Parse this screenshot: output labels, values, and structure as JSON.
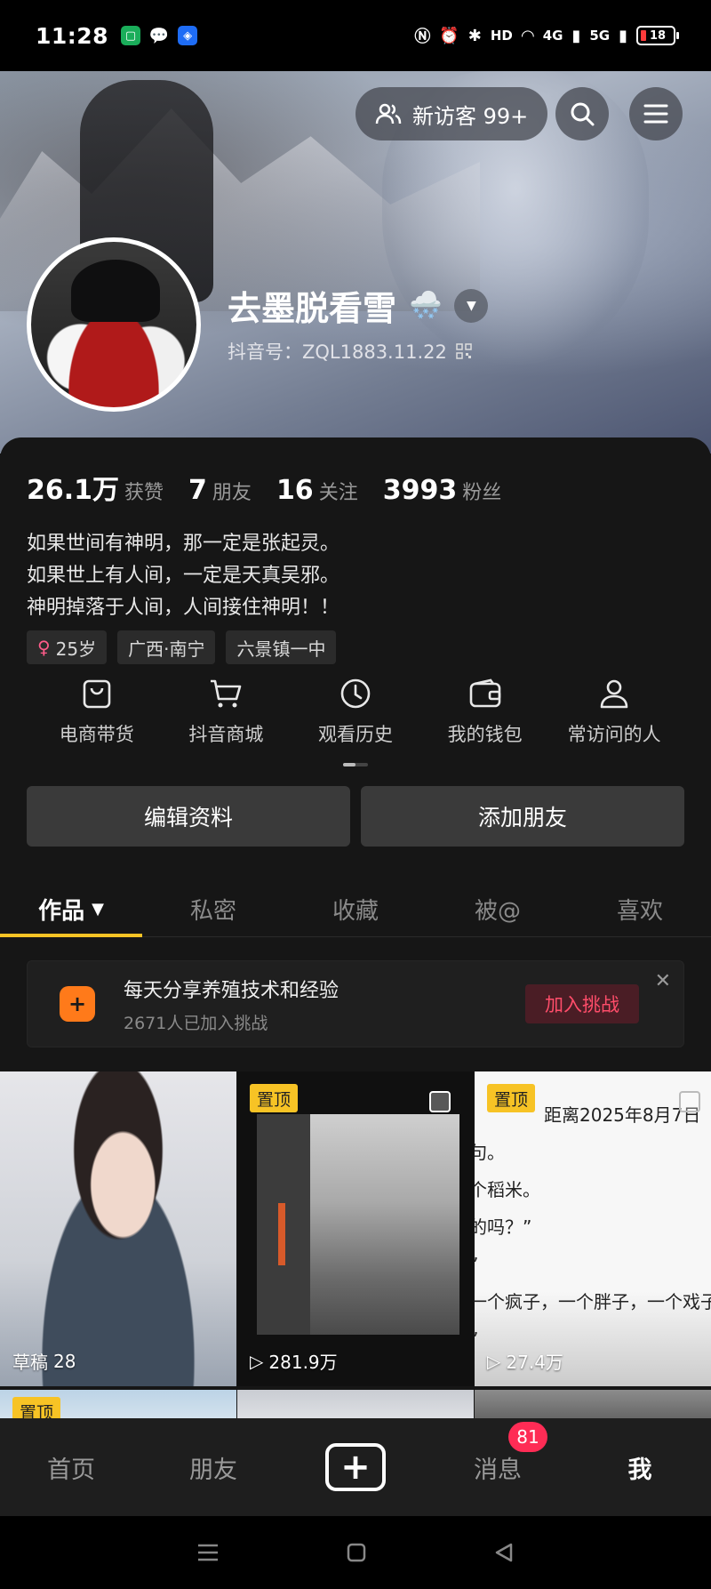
{
  "status_bar": {
    "time": "11:28",
    "battery": "18",
    "network_labels": [
      "HD",
      "4G",
      "5G"
    ]
  },
  "header": {
    "visitor_label": "新访客 99+",
    "nickname": "去墨脱看雪",
    "nickname_emoji": "🌨️",
    "douyin_id": "抖音号：ZQL1883.11.22"
  },
  "stats": [
    {
      "value": "26.1万",
      "label": "获赞"
    },
    {
      "value": "7",
      "label": "朋友"
    },
    {
      "value": "16",
      "label": "关注"
    },
    {
      "value": "3993",
      "label": "粉丝"
    }
  ],
  "bio": [
    "如果世间有神明，那一定是张起灵。",
    "如果世上有人间，一定是天真吴邪。",
    "神明掉落于人间，人间接住神明！！"
  ],
  "tags": [
    {
      "icon": "female-icon",
      "text": "25岁"
    },
    {
      "text": "广西·南宁"
    },
    {
      "text": "六景镇一中"
    }
  ],
  "shortcuts": [
    {
      "icon": "shopping-bag-icon",
      "label": "电商带货"
    },
    {
      "icon": "cart-icon",
      "label": "抖音商城"
    },
    {
      "icon": "clock-icon",
      "label": "观看历史"
    },
    {
      "icon": "wallet-icon",
      "label": "我的钱包"
    },
    {
      "icon": "person-icon",
      "label": "常访问的人"
    }
  ],
  "actions": {
    "edit_profile": "编辑资料",
    "add_friend": "添加朋友"
  },
  "tabs": [
    {
      "label": "作品",
      "active": true
    },
    {
      "label": "私密"
    },
    {
      "label": "收藏"
    },
    {
      "label": "被@"
    },
    {
      "label": "喜欢"
    }
  ],
  "challenge": {
    "title": "每天分享养殖技术和经验",
    "subtitle": "2671人已加入挑战",
    "join_label": "加入挑战",
    "close_symbol": "✕"
  },
  "grid": {
    "pin_label": "置顶",
    "items": [
      {
        "meta_prefix": "草稿",
        "meta_value": "28",
        "pinned": false
      },
      {
        "meta_value": "281.9万",
        "pinned": true
      },
      {
        "meta_value": "27.4万",
        "pinned": true
      }
    ],
    "cell3_text_lines": [
      "距离2025年8月7日",
      "句。",
      "个稻米。",
      "的吗？”",
      "”",
      "一个疯子，一个胖子，一个戏子",
      "”"
    ]
  },
  "bottom_nav": [
    {
      "label": "首页"
    },
    {
      "label": "朋友"
    },
    {
      "label": "+"
    },
    {
      "label": "消息",
      "badge": "81"
    },
    {
      "label": "我",
      "active": true
    }
  ],
  "colors": {
    "accent": "#f7c325",
    "badge": "#fe2c55",
    "background": "#161616",
    "challenge_icon": "#ff7a1a"
  }
}
